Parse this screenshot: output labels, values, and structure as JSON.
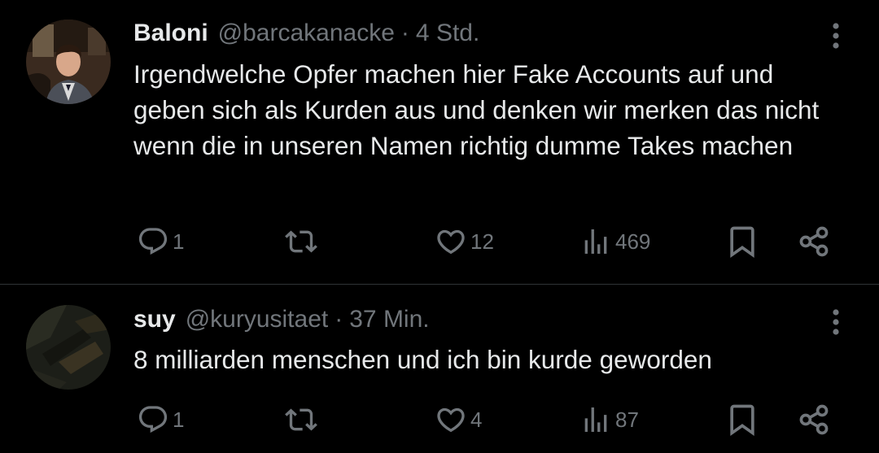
{
  "tweets": [
    {
      "name": "Baloni",
      "handle": "@barcakanacke",
      "separator": "·",
      "time": "4 Std.",
      "text": "Irgendwelche Opfer machen hier Fake Accounts auf und geben sich als Kurden aus und denken wir merken das nicht wenn die in unseren Namen richtig dumme Takes machen",
      "replies": "1",
      "retweets": "",
      "likes": "12",
      "views": "469",
      "avatar_icon": "person-in-suit-avatar"
    },
    {
      "name": "suy",
      "handle": "@kuryusitaet",
      "separator": "·",
      "time": "37 Min.",
      "text": "8 milliarden menschen und ich bin kurde geworden",
      "replies": "1",
      "retweets": "",
      "likes": "4",
      "views": "87",
      "avatar_icon": "dark-abstract-avatar"
    }
  ],
  "icons": {
    "reply": "speech-bubble-icon",
    "retweet": "retweet-arrows-icon",
    "like": "heart-icon",
    "views": "bar-chart-icon",
    "bookmark": "bookmark-icon",
    "share": "share-icon",
    "more": "vertical-ellipsis-icon"
  },
  "colors": {
    "background": "#000000",
    "primary_text": "#e7e9ea",
    "secondary_text": "#71767b",
    "divider": "#2f3336"
  }
}
